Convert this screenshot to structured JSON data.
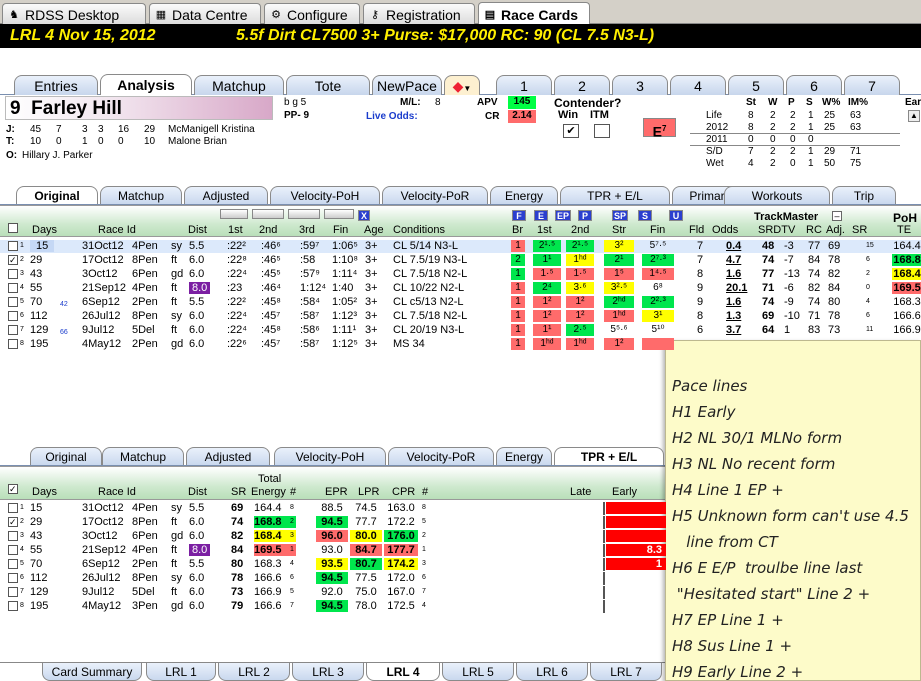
{
  "top_tabs": [
    {
      "label": "RDSS Desktop",
      "icon": "horse-icon"
    },
    {
      "label": "Data Centre",
      "icon": "table-icon"
    },
    {
      "label": "Configure",
      "icon": "gear-icon"
    },
    {
      "label": "Registration",
      "icon": "key-icon"
    },
    {
      "label": "Race Cards",
      "icon": "card-icon"
    }
  ],
  "banner": {
    "race": "LRL  4  Nov 15, 2012",
    "details": "5.5f  Dirt  CL7500  3+  Purse: $17,000  RC: 90  (CL 7.5 N3-L)"
  },
  "main_tabs": [
    "Entries",
    "Analysis",
    "Matchup",
    "Tote",
    "NewPace"
  ],
  "number_tabs": [
    "1",
    "2",
    "3",
    "4",
    "5",
    "6",
    "7"
  ],
  "horse": {
    "pp_number": "9",
    "name": "Farley Hill",
    "sex_age": "b g 5",
    "pp": "PP- 9",
    "ml_label": "M/L:",
    "ml_value": "8",
    "live_odds_label": "Live Odds:",
    "apv_label": "APV",
    "apv_value": "145",
    "cr_label": "CR",
    "cr_value": "2.14",
    "contender_label": "Contender?",
    "win_label": "Win",
    "itm_label": "ITM",
    "e_rating": "E",
    "e_rating_sup": "7",
    "jockey_label": "J:",
    "jockey_stats": [
      "45",
      "7",
      "3",
      "3",
      "16",
      "29"
    ],
    "jockey_name": "McManigell Kristina",
    "trainer_label": "T:",
    "trainer_stats": [
      "10",
      "0",
      "1",
      "0",
      "0",
      "10"
    ],
    "trainer_name": "Malone Brian",
    "owner_label": "O:",
    "owner_name": "Hillary J. Parker"
  },
  "record": {
    "headers": [
      "St",
      "W",
      "P",
      "S",
      "W%",
      "IM%",
      "Ear"
    ],
    "rows": [
      {
        "label": "Life",
        "v": [
          "8",
          "2",
          "2",
          "1",
          "25",
          "63"
        ]
      },
      {
        "label": "2012",
        "v": [
          "8",
          "2",
          "2",
          "1",
          "25",
          "63"
        ]
      },
      {
        "label": "2011",
        "v": [
          "0",
          "0",
          "0",
          "0",
          "",
          ""
        ]
      },
      {
        "label": "S/D",
        "v": [
          "7",
          "2",
          "2",
          "1",
          "29",
          "71"
        ]
      },
      {
        "label": "Wet",
        "v": [
          "4",
          "2",
          "0",
          "1",
          "50",
          "75"
        ]
      }
    ]
  },
  "sub_tabs_1": [
    "Original",
    "Matchup",
    "Adjusted",
    "Velocity-PoH",
    "Velocity-PoR",
    "Energy",
    "TPR + E/L",
    "Primary",
    "Workouts",
    "Trip"
  ],
  "grid1": {
    "headers": {
      "days": "Days",
      "race_id": "Race Id",
      "dist": "Dist",
      "first": "1st",
      "second": "2nd",
      "third": "3rd",
      "fin": "Fin",
      "age": "Age",
      "conditions": "Conditions",
      "br": "Br",
      "c1st": "1st",
      "c2nd": "2nd",
      "str": "Str",
      "cfin": "Fin",
      "fld": "Fld",
      "odds": "Odds",
      "srdtv": "SRDTV",
      "rc": "RC",
      "adj": "Adj.",
      "sr": "SR",
      "trackmaster": "TrackMaster",
      "poh": "PoH",
      "te": "TE"
    },
    "buttons": [
      "F",
      "E",
      "EP",
      "P",
      "SP",
      "S",
      "U",
      "X"
    ],
    "rows": [
      {
        "n": "1",
        "days": "15",
        "sub": "",
        "race": "31Oct12",
        "trk": "4Pen",
        "surf": "sy",
        "dist": "5.5",
        "f1": ":22²",
        "f2": ":46⁶",
        "f3": ":59⁷",
        "fin": "1:06⁵",
        "age": "3+",
        "cond": "CL 5/14 N3-L",
        "br": "1",
        "b1": "2¹·⁵",
        "b2": "2¹·⁵",
        "str": "3²",
        "bfin": "5⁷·⁵",
        "fld": "7",
        "odds": "0.4",
        "sr": "48",
        "tv": "-3",
        "rc": "77",
        "adj": "69",
        "srr": "15",
        "te": "164.4"
      },
      {
        "n": "2",
        "days": "29",
        "sub": "",
        "race": "17Oct12",
        "trk": "8Pen",
        "surf": "ft",
        "dist": "6.0",
        "f1": ":22⁸",
        "f2": ":46⁵",
        "f3": ":58",
        "fin": "1:10⁸",
        "age": "3+",
        "cond": "CL 7.5/19 N3-L",
        "br": "2",
        "b1": "1¹",
        "b2": "1ʰᵈ",
        "str": "2¹",
        "bfin": "2⁷·³",
        "fld": "7",
        "odds": "4.7",
        "sr": "74",
        "tv": "-7",
        "rc": "84",
        "adj": "78",
        "srr": "6",
        "te": "168.8"
      },
      {
        "n": "3",
        "days": "43",
        "sub": "",
        "race": "3Oct12",
        "trk": "6Pen",
        "surf": "gd",
        "dist": "6.0",
        "f1": ":22⁴",
        "f2": ":45⁵",
        "f3": ":57⁹",
        "fin": "1:11⁴",
        "age": "3+",
        "cond": "CL 7.5/18 N2-L",
        "br": "1",
        "b1": "1·⁵",
        "b2": "1·⁵",
        "str": "1⁵",
        "bfin": "1⁴·⁵",
        "fld": "8",
        "odds": "1.6",
        "sr": "77",
        "tv": "-13",
        "rc": "74",
        "adj": "82",
        "srr": "2",
        "te": "168.4"
      },
      {
        "n": "4",
        "days": "55",
        "sub": "",
        "race": "21Sep12",
        "trk": "4Pen",
        "surf": "ft",
        "dist": "8.0",
        "f1": ":23",
        "f2": ":46⁴",
        "f3": "1:12⁴",
        "fin": "1:40",
        "age": "3+",
        "cond": "CL 10/22 N2-L",
        "br": "1",
        "b1": "2⁴",
        "b2": "3·⁶",
        "str": "3²·⁵",
        "bfin": "6⁸",
        "fld": "9",
        "odds": "20.1",
        "sr": "71",
        "tv": "-6",
        "rc": "82",
        "adj": "84",
        "srr": "0",
        "te": "169.5"
      },
      {
        "n": "5",
        "days": "70",
        "sub": "42",
        "race": "6Sep12",
        "trk": "2Pen",
        "surf": "ft",
        "dist": "5.5",
        "f1": ":22²",
        "f2": ":45⁸",
        "f3": ":58⁴",
        "fin": "1:05²",
        "age": "3+",
        "cond": "CL c5/13 N2-L",
        "br": "1",
        "b1": "1²",
        "b2": "1²",
        "str": "2ʰᵈ",
        "bfin": "2²·³",
        "fld": "9",
        "odds": "1.6",
        "sr": "74",
        "tv": "-9",
        "rc": "74",
        "adj": "80",
        "srr": "4",
        "te": "168.3"
      },
      {
        "n": "6",
        "days": "112",
        "sub": "",
        "race": "26Jul12",
        "trk": "8Pen",
        "surf": "sy",
        "dist": "6.0",
        "f1": ":22⁴",
        "f2": ":45⁷",
        "f3": ":58⁷",
        "fin": "1:12³",
        "age": "3+",
        "cond": "CL 7.5/18 N2-L",
        "br": "1",
        "b1": "1²",
        "b2": "1²",
        "str": "1ʰᵈ",
        "bfin": "3¹",
        "fld": "8",
        "odds": "1.3",
        "sr": "69",
        "tv": "-10",
        "rc": "71",
        "adj": "78",
        "srr": "6",
        "te": "166.6"
      },
      {
        "n": "7",
        "days": "129",
        "sub": "66",
        "race": "9Jul12",
        "trk": "5Del",
        "surf": "ft",
        "dist": "6.0",
        "f1": ":22⁴",
        "f2": ":45⁸",
        "f3": ":58⁶",
        "fin": "1:11¹",
        "age": "3+",
        "cond": "CL 20/19 N3-L",
        "br": "1",
        "b1": "1¹",
        "b2": "2·⁵",
        "str": "5⁵·⁶",
        "bfin": "5¹⁰",
        "fld": "6",
        "odds": "3.7",
        "sr": "64",
        "tv": "1",
        "rc": "83",
        "adj": "73",
        "srr": "11",
        "te": "166.9"
      },
      {
        "n": "8",
        "days": "195",
        "sub": "",
        "race": "4May12",
        "trk": "2Pen",
        "surf": "gd",
        "dist": "6.0",
        "f1": ":22⁶",
        "f2": ":45⁷",
        "f3": ":58⁷",
        "fin": "1:12⁵",
        "age": "3+",
        "cond": "MS 34",
        "br": "1",
        "b1": "1ʰᵈ",
        "b2": "1ʰᵈ",
        "str": "1²",
        "bfin": "",
        "fld": "",
        "odds": "",
        "sr": "",
        "tv": "",
        "rc": "",
        "adj": "",
        "srr": "",
        "te": ""
      }
    ]
  },
  "sub_tabs_2": [
    "Original",
    "Matchup",
    "Adjusted",
    "Velocity-PoH",
    "Velocity-PoR",
    "Energy",
    "TPR + E/L"
  ],
  "grid2": {
    "headers": {
      "days": "Days",
      "race_id": "Race Id",
      "dist": "Dist",
      "sr": "SR",
      "total": "Total",
      "energy": "Energy",
      "hash": "#",
      "epr": "EPR",
      "lpr": "LPR",
      "cpr": "CPR",
      "hash2": "#",
      "late": "Late",
      "early": "Early"
    },
    "rows": [
      {
        "n": "1",
        "days": "15",
        "race": "31Oct12",
        "trk": "4Pen",
        "surf": "sy",
        "dist": "5.5",
        "sr": "69",
        "energy": "164.4",
        "er": "8",
        "epr": "88.5",
        "lpr": "74.5",
        "cpr": "163.0",
        "cr": "8",
        "early": ""
      },
      {
        "n": "2",
        "days": "29",
        "race": "17Oct12",
        "trk": "8Pen",
        "surf": "ft",
        "dist": "6.0",
        "sr": "74",
        "energy": "168.8",
        "er": "2",
        "epr": "94.5",
        "lpr": "77.7",
        "cpr": "172.2",
        "cr": "5",
        "early": ""
      },
      {
        "n": "3",
        "days": "43",
        "race": "3Oct12",
        "trk": "6Pen",
        "surf": "gd",
        "dist": "6.0",
        "sr": "82",
        "energy": "168.4",
        "er": "3",
        "epr": "96.0",
        "lpr": "80.0",
        "cpr": "176.0",
        "cr": "2",
        "early": ""
      },
      {
        "n": "4",
        "days": "55",
        "race": "21Sep12",
        "trk": "4Pen",
        "surf": "ft",
        "dist": "8.0",
        "sr": "84",
        "energy": "169.5",
        "er": "1",
        "epr": "93.0",
        "lpr": "84.7",
        "cpr": "177.7",
        "cr": "1",
        "early": "8.3"
      },
      {
        "n": "5",
        "days": "70",
        "race": "6Sep12",
        "trk": "2Pen",
        "surf": "ft",
        "dist": "5.5",
        "sr": "80",
        "energy": "168.3",
        "er": "4",
        "epr": "93.5",
        "lpr": "80.7",
        "cpr": "174.2",
        "cr": "3",
        "early": "1"
      },
      {
        "n": "6",
        "days": "112",
        "race": "26Jul12",
        "trk": "8Pen",
        "surf": "sy",
        "dist": "6.0",
        "sr": "78",
        "energy": "166.6",
        "er": "6",
        "epr": "94.5",
        "lpr": "77.5",
        "cpr": "172.0",
        "cr": "6",
        "early": ""
      },
      {
        "n": "7",
        "days": "129",
        "race": "9Jul12",
        "trk": "5Del",
        "surf": "ft",
        "dist": "6.0",
        "sr": "73",
        "energy": "166.9",
        "er": "5",
        "epr": "92.0",
        "lpr": "75.0",
        "cpr": "167.0",
        "cr": "7",
        "early": ""
      },
      {
        "n": "8",
        "days": "195",
        "race": "4May12",
        "trk": "3Pen",
        "surf": "gd",
        "dist": "6.0",
        "sr": "79",
        "energy": "166.6",
        "er": "7",
        "epr": "94.5",
        "lpr": "78.0",
        "cpr": "172.5",
        "cr": "4",
        "early": ""
      }
    ]
  },
  "bottom_tabs": [
    "Card Summary",
    "LRL 1",
    "LRL 2",
    "LRL 3",
    "LRL 4",
    "LRL 5",
    "LRL 6",
    "LRL 7"
  ],
  "note": {
    "lines": [
      "Pace lines",
      "H1 Early",
      "H2 NL 30/1 MLNo form",
      "H3 NL No recent form",
      "H4 Line 1 EP +",
      "H5 Unknown form can't use 4.5",
      "   line from CT",
      "H6 E E/P  troulbe line last",
      " \"Hesitated start\" Line 2 +",
      "H7 EP Line 1 +",
      "H8 Sus Line 1 +",
      "H9 Early Line 2 +"
    ]
  },
  "colors": {
    "banner_text": "#ffef00",
    "green": "#00e64d",
    "red": "#ff6b6b",
    "yellow": "#ffff00",
    "purple": "#7b1fa2"
  }
}
